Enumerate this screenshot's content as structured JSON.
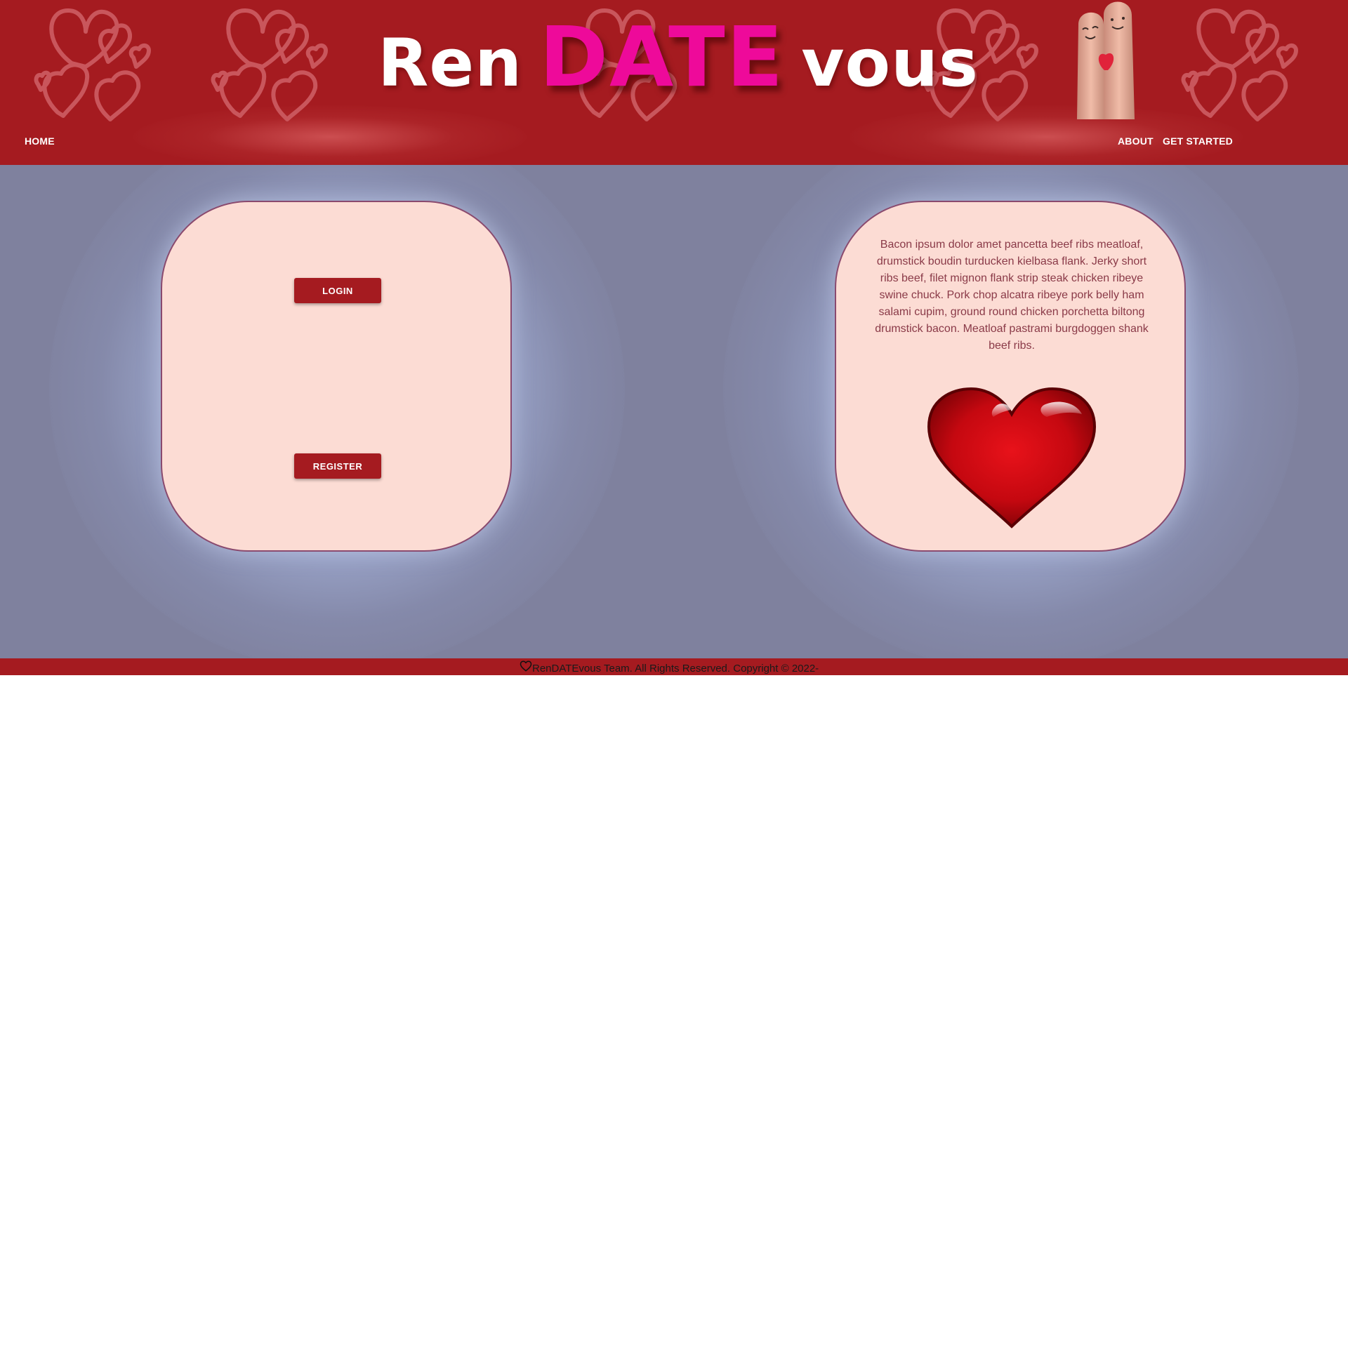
{
  "header": {
    "title_parts": [
      "Ren",
      "DATE",
      "vous"
    ],
    "colors": {
      "background": "#a51b20",
      "title_white": "#ffffff",
      "title_pink": "#ee0a9a"
    },
    "decorations": [
      "hearts-pattern",
      "couple-fingers-image"
    ]
  },
  "nav": {
    "home": "HOME",
    "about": "ABOUT",
    "get_started": "GET STARTED"
  },
  "auth_card": {
    "login_label": "LOGIN",
    "register_label": "REGISTER"
  },
  "info_card": {
    "text": "Bacon ipsum dolor amet pancetta beef ribs meatloaf, drumstick boudin turducken kielbasa flank. Jerky short ribs beef, filet mignon flank strip steak chicken ribeye swine chuck. Pork chop alcatra ribeye pork belly ham salami cupim, ground round chicken porchetta biltong drumstick bacon. Meatloaf pastrami burgdoggen shank beef ribs.",
    "image": "red-glossy-heart"
  },
  "footer": {
    "text": "RenDATEvous Team. All Rights Reserved. Copyright © 2022-",
    "icon": "heart-outline-icon"
  },
  "theme": {
    "main_background": "#7f819e",
    "card_background": "#fcdcd4",
    "card_border": "#8a4a6e",
    "button_color": "#a51b20"
  }
}
